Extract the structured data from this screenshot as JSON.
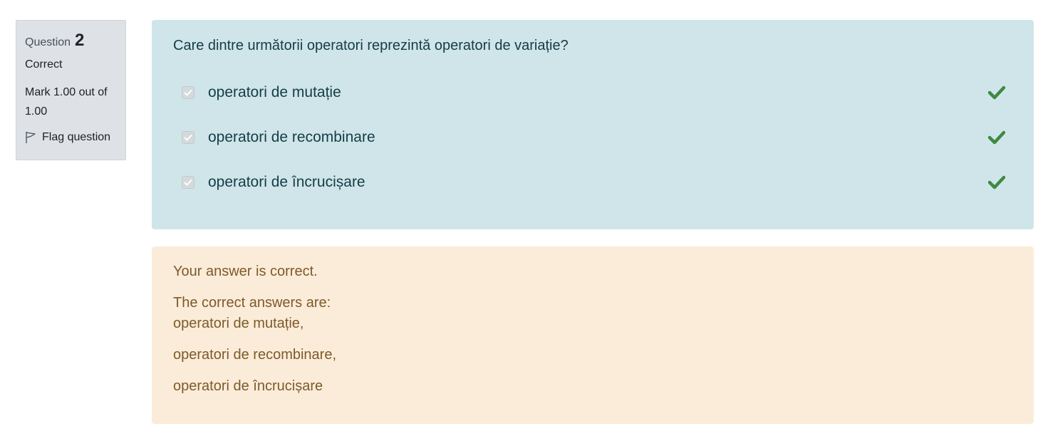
{
  "info": {
    "question_label": "Question",
    "question_number": "2",
    "state": "Correct",
    "grade": "Mark 1.00 out of 1.00",
    "flag_label": "Flag question"
  },
  "question": {
    "text": "Care dintre următorii operatori reprezintă operatori de variație?",
    "answers": [
      {
        "label": "operatori de mutație",
        "checked": true,
        "correct": true
      },
      {
        "label": "operatori de recombinare",
        "checked": true,
        "correct": true
      },
      {
        "label": "operatori de încrucișare",
        "checked": true,
        "correct": true
      }
    ]
  },
  "outcome": {
    "feedback": "Your answer is correct.",
    "right_answer_title": "The correct answers are:",
    "right_answers": [
      "operatori de mutație,",
      "operatori de recombinare,",
      "operatori de încrucișare"
    ]
  },
  "colors": {
    "info_bg": "#dee2e6",
    "formulation_bg": "#cfe5ea",
    "outcome_bg": "#fbecd9",
    "tick": "#3e8a3e"
  }
}
